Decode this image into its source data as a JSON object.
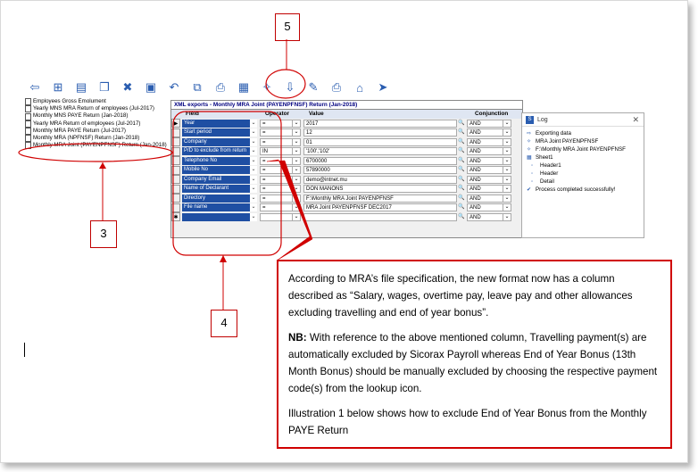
{
  "callouts": {
    "c5": "5",
    "c3": "3",
    "c4": "4"
  },
  "toolbar_icons": [
    "back-arrow",
    "tree",
    "doc",
    "docs",
    "delete",
    "save",
    "undo",
    "copy",
    "print",
    "report",
    "wand",
    "export-selected",
    "edit",
    "print2",
    "home",
    "run"
  ],
  "tree": {
    "items": [
      "Employees Gross Emolument",
      "Yearly MNS MRA Return of employees (Jul-2017)",
      "Monthly MNS PAYE Return (Jan-2018)",
      "Yearly MRA Return of employees (Jul-2017)",
      "Monthly MRA PAYE Return (Jul-2017)",
      "Monthly MRA (NPFNSF) Return (Jan-2018)",
      "Monthly MRA Joint (PAYENPFNSF) Return (Jan-2018)"
    ]
  },
  "grid": {
    "title": "XML exports - Monthly MRA Joint (PAYENPFNSF) Return (Jan-2018)",
    "headers": {
      "field": "Field",
      "operator": "Operator",
      "value": "Value",
      "conjunction": "Conjunction"
    },
    "rows": [
      {
        "ind": "▶",
        "field": "Year",
        "op": "=",
        "value": "2017",
        "conj": "AND"
      },
      {
        "ind": "",
        "field": "Start period",
        "op": "=",
        "value": "12",
        "conj": "AND"
      },
      {
        "ind": "",
        "field": "Company",
        "op": "=",
        "value": "01",
        "conj": "AND"
      },
      {
        "ind": "",
        "field": "P/D to exclude from return",
        "op": "IN",
        "value": "'100','102'",
        "conj": "AND"
      },
      {
        "ind": "",
        "field": "Telephone No",
        "op": "=",
        "value": "6700000",
        "conj": "AND"
      },
      {
        "ind": "",
        "field": "Mobile No",
        "op": "=",
        "value": "57890000",
        "conj": "AND"
      },
      {
        "ind": "",
        "field": "Company Email",
        "op": "=",
        "value": "demo@intnet.mu",
        "conj": "AND"
      },
      {
        "ind": "",
        "field": "Name of Declarant",
        "op": "=",
        "value": "DON MANONS",
        "conj": "AND"
      },
      {
        "ind": "",
        "field": "Directory",
        "op": "=",
        "value": "F:\\Monthly MRA Joint PAYENPFNSF",
        "conj": "AND"
      },
      {
        "ind": "",
        "field": "File name",
        "op": "=",
        "value": "MRA Joint PAYENPFNSF DEC2017",
        "conj": "AND"
      },
      {
        "ind": "✱",
        "field": "",
        "op": "",
        "value": "",
        "conj": "AND"
      }
    ]
  },
  "log": {
    "title": "Log",
    "items": [
      {
        "icon": "arrow-icon",
        "text": "Exporting data",
        "indent": 0
      },
      {
        "icon": "wand-icon",
        "text": "MRA Joint PAYENPFNSF",
        "indent": 0
      },
      {
        "icon": "wand-icon",
        "text": "F:\\Monthly MRA Joint PAYENPFNSF",
        "indent": 0
      },
      {
        "icon": "sheet-icon",
        "text": "Sheet1",
        "indent": 0
      },
      {
        "icon": "bullet-icon",
        "text": "Header1",
        "indent": 1
      },
      {
        "icon": "bullet-icon",
        "text": "Header",
        "indent": 1
      },
      {
        "icon": "bullet-icon",
        "text": "Detail",
        "indent": 1
      },
      {
        "icon": "check-icon",
        "text": "Process completed successfully!",
        "indent": 0
      }
    ]
  },
  "note": {
    "p1": "According to MRA’s file specification, the new format now has a column described as “Salary, wages, overtime pay, leave pay and other allowances excluding travelling and end of year bonus”.",
    "p2_bold": "NB:",
    "p2": " With reference to the above mentioned column, Travelling payment(s) are automatically  excluded by Sicorax Payroll whereas End of Year Bonus (13th Month Bonus) should be manually excluded by choosing the respective payment code(s) from the lookup icon.",
    "p3": "Illustration 1 below shows how to exclude End of Year Bonus from the Monthly PAYE Return"
  },
  "colors": {
    "accent_red": "#d00000",
    "field_blue": "#1f4fa3"
  }
}
